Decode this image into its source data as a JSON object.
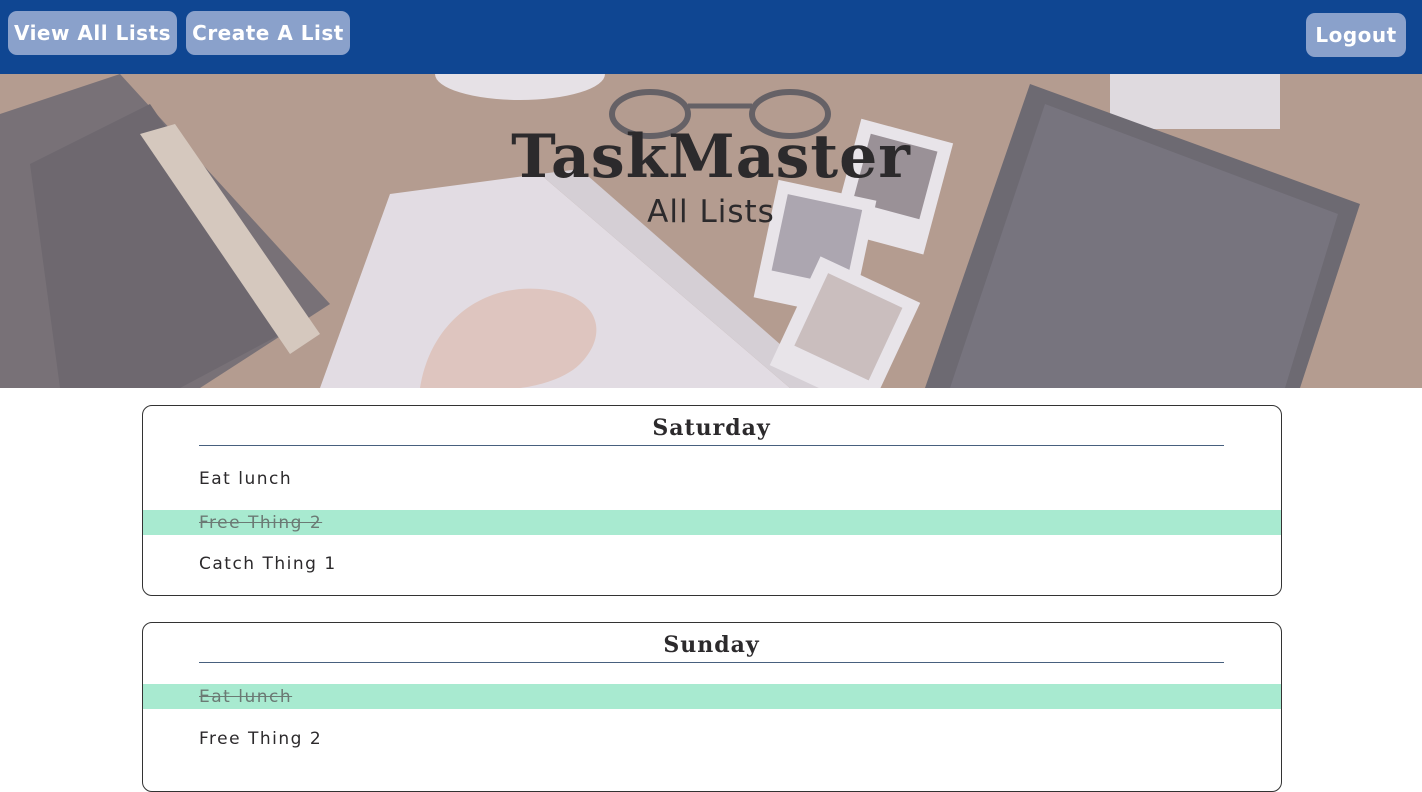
{
  "nav": {
    "view_all": "View All Lists",
    "create": "Create A List",
    "logout": "Logout"
  },
  "hero": {
    "title": "TaskMaster",
    "subtitle": "All Lists"
  },
  "lists": [
    {
      "name": "Saturday",
      "tasks": [
        {
          "label": "Eat lunch",
          "done": false
        },
        {
          "label": "Free Thing 2",
          "done": true
        },
        {
          "label": "Catch Thing 1",
          "done": false
        }
      ]
    },
    {
      "name": "Sunday",
      "tasks": [
        {
          "label": "Eat lunch",
          "done": true
        },
        {
          "label": "Free Thing 2",
          "done": false
        }
      ]
    }
  ],
  "colors": {
    "nav_bg": "#0f4692",
    "nav_button": "#8aa1cb",
    "done_highlight": "#a8ead0"
  }
}
